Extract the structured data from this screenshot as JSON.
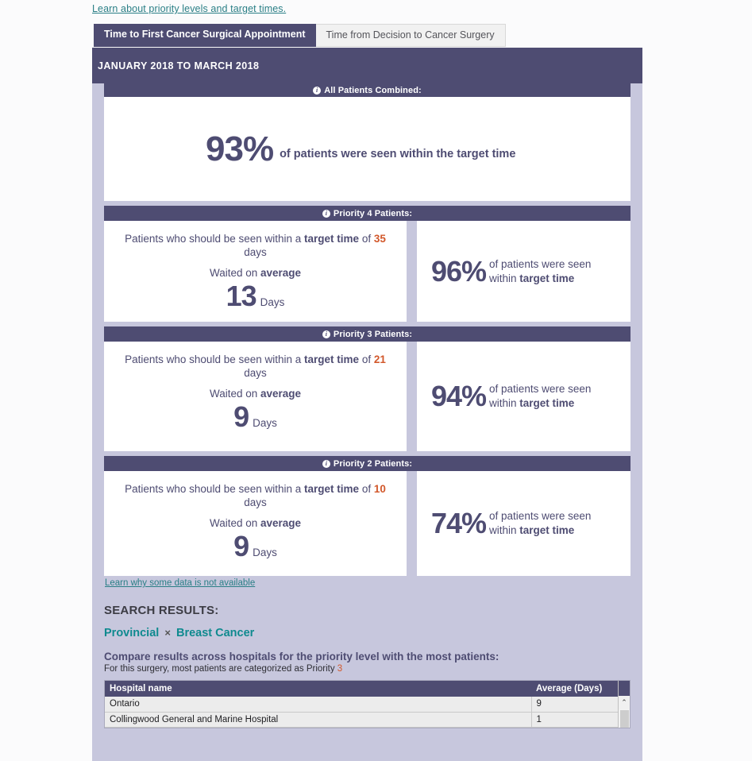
{
  "top_link": "Learn about priority levels and target times.",
  "tabs": [
    {
      "label": "Time to First Cancer Surgical Appointment",
      "active": true
    },
    {
      "label": "Time from Decision to Cancer Surgery",
      "active": false
    }
  ],
  "period": "JANUARY 2018 TO MARCH 2018",
  "combined": {
    "header": "All Patients Combined:",
    "percent": "93%",
    "caption": "of patients were seen within the target time"
  },
  "priorities": [
    {
      "header": "Priority 4 Patients:",
      "left_pre": "Patients who should be seen within a ",
      "left_bold": "target time",
      "left_of": " of ",
      "target_days": "35",
      "left_post": " days",
      "waited_pre": "Waited on ",
      "waited_bold": "average",
      "avg_days": "13",
      "days_label": "Days",
      "percent": "96%",
      "pct_text_pre": "of patients were seen within ",
      "pct_text_bold": "target time"
    },
    {
      "header": "Priority 3 Patients:",
      "left_pre": "Patients who should be seen within a ",
      "left_bold": "target time",
      "left_of": " of ",
      "target_days": "21",
      "left_post": " days",
      "waited_pre": "Waited on ",
      "waited_bold": "average",
      "avg_days": "9",
      "days_label": "Days",
      "percent": "94%",
      "pct_text_pre": "of patients were seen within ",
      "pct_text_bold": "target time"
    },
    {
      "header": "Priority 2 Patients:",
      "left_pre": "Patients who should be seen within a ",
      "left_bold": "target time",
      "left_of": " of ",
      "target_days": "10",
      "left_post": " days",
      "waited_pre": "Waited on ",
      "waited_bold": "average",
      "avg_days": "9",
      "days_label": "Days",
      "percent": "74%",
      "pct_text_pre": "of patients were seen within ",
      "pct_text_bold": "target time"
    }
  ],
  "learn_why": "Learn why some data is not available",
  "search_results": {
    "title": "SEARCH RESULTS:",
    "tags": [
      "Provincial",
      "Breast Cancer"
    ],
    "tag_separator": "×",
    "compare_heading": "Compare results across hospitals for the priority level with the most patients:",
    "sub_pre": "For this surgery, most patients are categorized as Priority ",
    "sub_priority": "3",
    "table": {
      "columns": [
        "Hospital name",
        "Average (Days)"
      ],
      "rows": [
        [
          "Ontario",
          "9"
        ],
        [
          "Collingwood General and Marine Hospital",
          "1"
        ]
      ]
    }
  },
  "icons": {
    "info": "i",
    "scroll_up": "⌃"
  },
  "colors": {
    "brand_purple": "#4e4c72",
    "panel_lavender": "#c7c7dd",
    "link_teal": "#2a7f86",
    "tag_teal": "#0f8a8f",
    "accent_orange": "#d2582b"
  }
}
